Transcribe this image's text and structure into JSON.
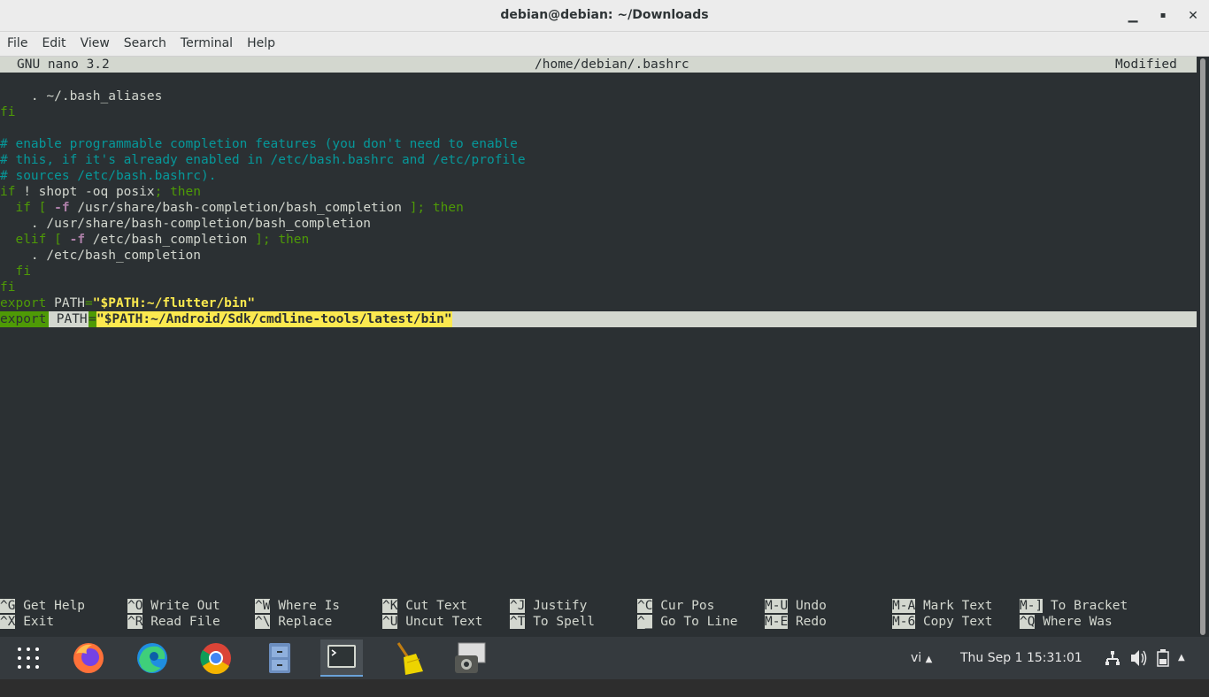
{
  "window": {
    "title": "debian@debian: ~/Downloads",
    "minimize": "▁",
    "maximize": "▪",
    "close": "✕"
  },
  "menu": [
    "File",
    "Edit",
    "View",
    "Search",
    "Terminal",
    "Help"
  ],
  "nano": {
    "version": "GNU nano 3.2",
    "file": "/home/debian/.bashrc",
    "status": "Modified"
  },
  "code": {
    "l1": "    . ~/.bash_aliases",
    "l2": "fi",
    "c1": "# enable programmable completion features (you don't need to enable",
    "c2": "# this, if it's already enabled in /etc/bash.bashrc and /etc/profile",
    "c3": "# sources /etc/bash.bashrc).",
    "l6a": "if",
    "l6b": " ! shopt -oq posix",
    "l6c": "; then",
    "l7a": "  if",
    "l7b": " [ ",
    "l7c": "-f",
    "l7d": " /usr/share/bash-completion/bash_completion ",
    "l7e": "]; then",
    "l8": "    . /usr/share/bash-completion/bash_completion",
    "l9a": "  elif",
    "l9b": " [ ",
    "l9c": "-f",
    "l9d": " /etc/bash_completion ",
    "l9e": "]; then",
    "l10": "    . /etc/bash_completion",
    "l11": "  fi",
    "l12": "fi",
    "e1a": "export",
    "e1b": " PATH",
    "e1c": "=",
    "e1d": "\"$PATH:~/flutter/bin\"",
    "e2a": "export",
    "e2b": " PATH",
    "e2c": "=",
    "e2d": "\"$PATH:~/Android/Sdk/cmdline-tools/latest/bin\""
  },
  "shortcuts": [
    {
      "key": "^G",
      "label": "Get Help"
    },
    {
      "key": "^O",
      "label": "Write Out"
    },
    {
      "key": "^W",
      "label": "Where Is"
    },
    {
      "key": "^K",
      "label": "Cut Text"
    },
    {
      "key": "^J",
      "label": "Justify"
    },
    {
      "key": "^C",
      "label": "Cur Pos"
    },
    {
      "key": "M-U",
      "label": "Undo"
    },
    {
      "key": "M-A",
      "label": "Mark Text"
    },
    {
      "key": "M-]",
      "label": "To Bracket"
    },
    {
      "key": "^X",
      "label": "Exit"
    },
    {
      "key": "^R",
      "label": "Read File"
    },
    {
      "key": "^\\",
      "label": "Replace"
    },
    {
      "key": "^U",
      "label": "Uncut Text"
    },
    {
      "key": "^T",
      "label": "To Spell"
    },
    {
      "key": "^_",
      "label": "Go To Line"
    },
    {
      "key": "M-E",
      "label": "Redo"
    },
    {
      "key": "M-6",
      "label": "Copy Text"
    },
    {
      "key": "^Q",
      "label": "Where Was"
    }
  ],
  "taskbar": {
    "keyboard": "vi",
    "datetime": "Thu Sep 1  15:31:01"
  }
}
